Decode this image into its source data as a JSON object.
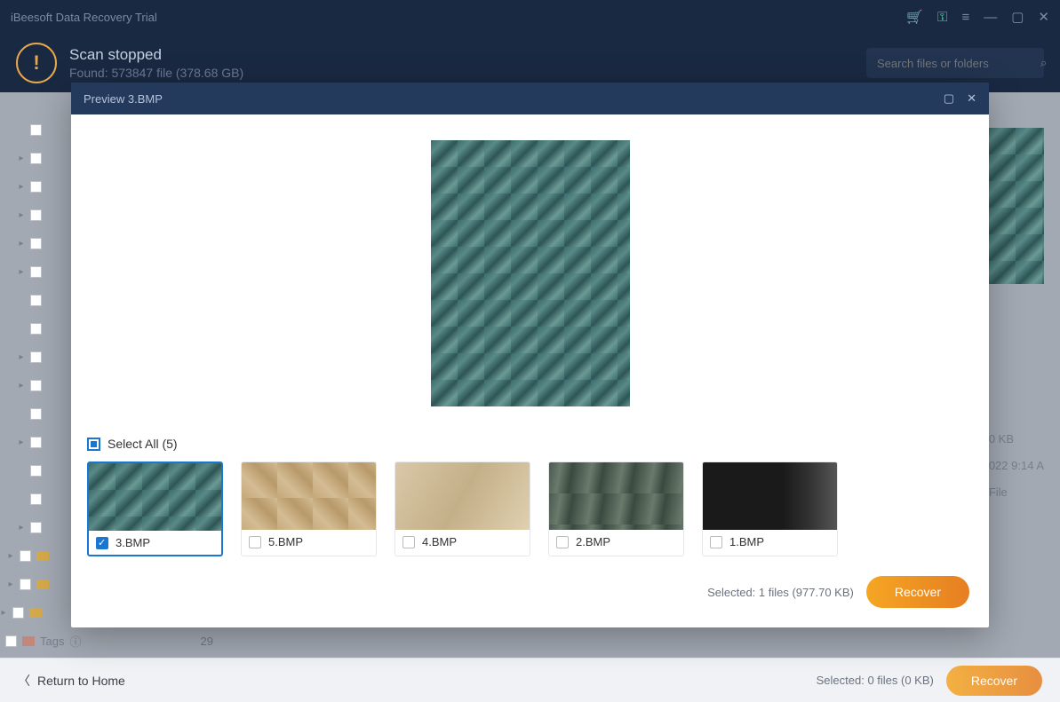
{
  "titlebar": {
    "title": "iBeesoft Data Recovery Trial"
  },
  "header": {
    "title": "Scan stopped",
    "subtitle": "Found: 573847 file (378.68 GB)",
    "search_placeholder": "Search files or folders"
  },
  "tree": {
    "tags_label": "Tags",
    "tags_count": "29"
  },
  "right_info": {
    "size": "0 KB",
    "date": "022 9:14 A",
    "type": "File"
  },
  "modal": {
    "title": "Preview 3.BMP",
    "select_all": "Select All (5)",
    "thumbs": [
      {
        "name": "3.BMP",
        "checked": true,
        "texture": "water"
      },
      {
        "name": "5.BMP",
        "checked": false,
        "texture": "beige"
      },
      {
        "name": "4.BMP",
        "checked": false,
        "texture": "tan"
      },
      {
        "name": "2.BMP",
        "checked": false,
        "texture": "greenish"
      },
      {
        "name": "1.BMP",
        "checked": false,
        "texture": "car"
      }
    ],
    "selected_text": "Selected: 1 files (977.70 KB)",
    "recover_label": "Recover"
  },
  "footer": {
    "back": "Return to Home",
    "selected": "Selected: 0 files (0 KB)",
    "recover": "Recover"
  }
}
